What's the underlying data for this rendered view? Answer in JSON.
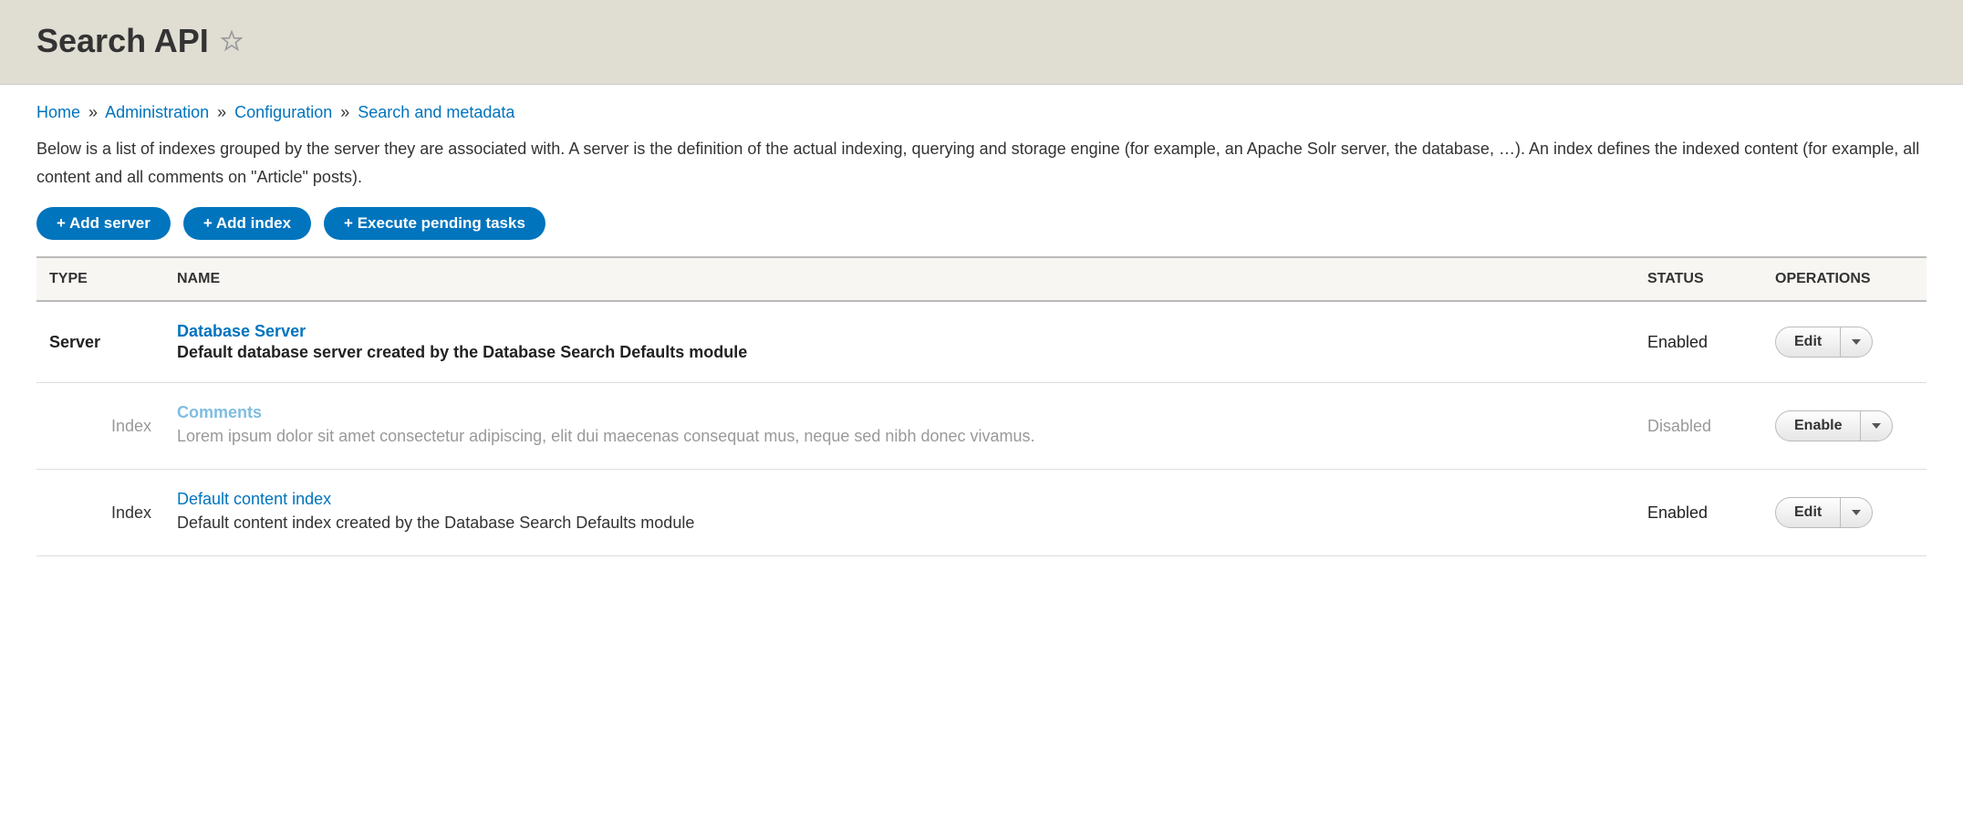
{
  "page": {
    "title": "Search API"
  },
  "breadcrumb": {
    "items": [
      {
        "label": "Home"
      },
      {
        "label": "Administration"
      },
      {
        "label": "Configuration"
      },
      {
        "label": "Search and metadata"
      }
    ],
    "sep": "»"
  },
  "description": "Below is a list of indexes grouped by the server they are associated with. A server is the definition of the actual indexing, querying and storage engine (for example, an Apache Solr server, the database, …). An index defines the indexed content (for example, all content and all comments on \"Article\" posts).",
  "actions": {
    "add_server": "+ Add server",
    "add_index": "+ Add index",
    "execute_tasks": "+ Execute pending tasks"
  },
  "table": {
    "headers": {
      "type": "TYPE",
      "name": "NAME",
      "status": "STATUS",
      "operations": "OPERATIONS"
    },
    "rows": [
      {
        "type": "Server",
        "type_class": "server",
        "name": "Database Server",
        "desc": "Default database server created by the Database Search Defaults module",
        "desc_bold": true,
        "status": "Enabled",
        "op": "Edit",
        "disabled": false
      },
      {
        "type": "Index",
        "type_class": "index",
        "name": "Comments",
        "desc": "Lorem ipsum dolor sit amet consectetur adipiscing, elit dui maecenas consequat mus, neque sed nibh donec vivamus.",
        "desc_bold": false,
        "status": "Disabled",
        "op": "Enable",
        "disabled": true
      },
      {
        "type": "Index",
        "type_class": "index",
        "name": "Default content index",
        "desc": "Default content index created by the Database Search Defaults module",
        "desc_bold": false,
        "status": "Enabled",
        "op": "Edit",
        "disabled": false
      }
    ]
  }
}
